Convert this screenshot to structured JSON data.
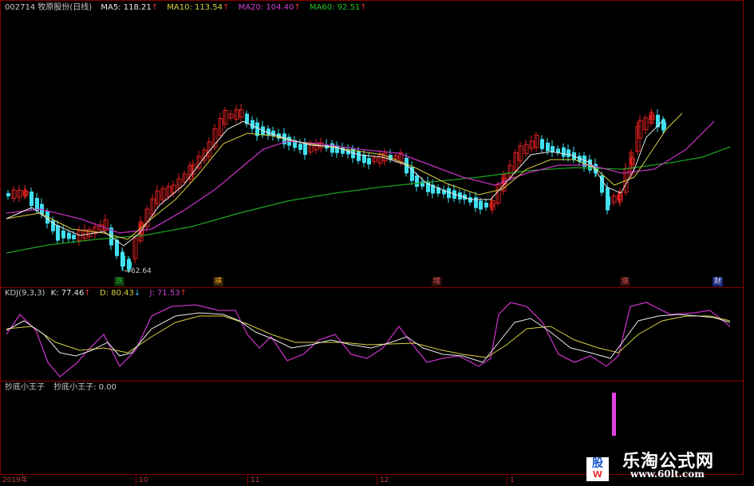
{
  "header": {
    "code_name": "002714 牧原股份(日线)",
    "ma5": "MA5: 118.21",
    "ma10": "MA10: 113.54",
    "ma20": "MA20: 104.40",
    "ma60": "MA60: 92.51",
    "arrow": "↑"
  },
  "colors": {
    "up": "#e83030",
    "down": "#40e0f0",
    "ma5": "#e8e8e8",
    "ma10": "#d8d040",
    "ma20": "#d040d0",
    "ma60": "#20a020",
    "frame": "#8b0000"
  },
  "price_chart": {
    "low_label": "62.64",
    "markers": [
      {
        "text": "跌",
        "color": "#20a020",
        "bg": "#1a3a1a"
      },
      {
        "text": "横",
        "color": "#e8a020",
        "bg": "#3a2a10"
      },
      {
        "text": "增",
        "color": "#e06060",
        "bg": "#3a1010"
      },
      {
        "text": "涨",
        "color": "#e06060",
        "bg": "#3a1010"
      },
      {
        "text": "财",
        "color": "#e0e0ff",
        "bg": "#1a2a7a"
      }
    ]
  },
  "kdj": {
    "title": "KDJ(9,3,3)",
    "k": "K: 77.46",
    "k_arrow": "↑",
    "d": "D: 80.43",
    "d_arrow": "↓",
    "j": "J: 71.53",
    "j_arrow": "↑",
    "colors": {
      "k": "#e8e8e8",
      "d": "#d8d040",
      "j": "#c030c0"
    }
  },
  "bottom_indicator": {
    "title": "抄底小王子",
    "value": "抄底小王子: 0.00",
    "bar_color": "#e040e0"
  },
  "x_axis": {
    "labels": [
      "2019年",
      "10",
      "11",
      "12",
      "1"
    ]
  },
  "watermark": {
    "site_name": "乐淘公式网",
    "url": "www.60lt.com",
    "logo_top": "股",
    "logo_bottom": "W"
  }
}
